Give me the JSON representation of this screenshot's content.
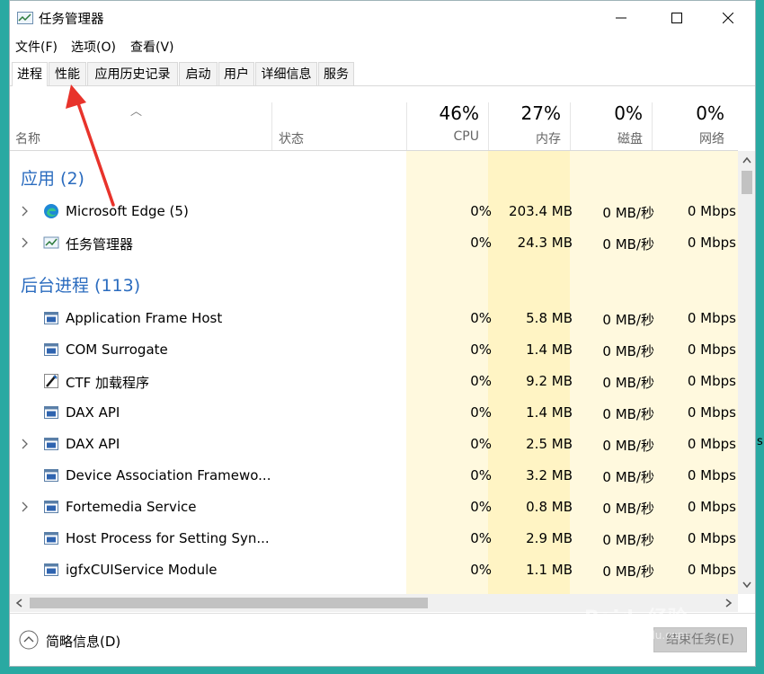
{
  "window": {
    "title": "任务管理器"
  },
  "menu": [
    "文件(F)",
    "选项(O)",
    "查看(V)"
  ],
  "tabs": [
    "进程",
    "性能",
    "应用历史记录",
    "启动",
    "用户",
    "详细信息",
    "服务"
  ],
  "headers": {
    "name": "名称",
    "status": "状态",
    "cpu": {
      "percent": "46%",
      "label": "CPU"
    },
    "memory": {
      "percent": "27%",
      "label": "内存"
    },
    "disk": {
      "percent": "0%",
      "label": "磁盘"
    },
    "network": {
      "percent": "0%",
      "label": "网络"
    }
  },
  "sections": {
    "apps": "应用 (2)",
    "background": "后台进程 (113)"
  },
  "apps": [
    {
      "name": "Microsoft Edge (5)",
      "cpu": "0%",
      "memory": "203.4 MB",
      "disk": "0 MB/秒",
      "network": "0 Mbps",
      "icon": "edge-icon",
      "expandable": true
    },
    {
      "name": "任务管理器",
      "cpu": "0%",
      "memory": "24.3 MB",
      "disk": "0 MB/秒",
      "network": "0 Mbps",
      "icon": "task-manager-icon",
      "expandable": true
    }
  ],
  "background": [
    {
      "name": "Application Frame Host",
      "cpu": "0%",
      "memory": "5.8 MB",
      "disk": "0 MB/秒",
      "network": "0 Mbps",
      "icon": "window-app-icon",
      "expandable": false
    },
    {
      "name": "COM Surrogate",
      "cpu": "0%",
      "memory": "1.4 MB",
      "disk": "0 MB/秒",
      "network": "0 Mbps",
      "icon": "window-app-icon",
      "expandable": false
    },
    {
      "name": "CTF 加载程序",
      "cpu": "0%",
      "memory": "9.2 MB",
      "disk": "0 MB/秒",
      "network": "0 Mbps",
      "icon": "ctf-pen-icon",
      "expandable": false
    },
    {
      "name": "DAX API",
      "cpu": "0%",
      "memory": "1.4 MB",
      "disk": "0 MB/秒",
      "network": "0 Mbps",
      "icon": "window-app-icon",
      "expandable": false
    },
    {
      "name": "DAX API",
      "cpu": "0%",
      "memory": "2.5 MB",
      "disk": "0 MB/秒",
      "network": "0 Mbps",
      "icon": "window-app-icon",
      "expandable": true
    },
    {
      "name": "Device Association Framewo...",
      "cpu": "0%",
      "memory": "3.2 MB",
      "disk": "0 MB/秒",
      "network": "0 Mbps",
      "icon": "window-app-icon",
      "expandable": false
    },
    {
      "name": "Fortemedia Service",
      "cpu": "0%",
      "memory": "0.8 MB",
      "disk": "0 MB/秒",
      "network": "0 Mbps",
      "icon": "window-app-icon",
      "expandable": true
    },
    {
      "name": "Host Process for Setting Syn...",
      "cpu": "0%",
      "memory": "2.9 MB",
      "disk": "0 MB/秒",
      "network": "0 Mbps",
      "icon": "window-app-icon",
      "expandable": false
    },
    {
      "name": "igfxCUIService Module",
      "cpu": "0%",
      "memory": "1.1 MB",
      "disk": "0 MB/秒",
      "network": "0 Mbps",
      "icon": "window-app-icon",
      "expandable": false
    }
  ],
  "footer": {
    "fewer_details": "简略信息(D)",
    "end_task": "结束任务(E)"
  },
  "watermark": {
    "brand": "Baidu经验",
    "url": "jingyan.baidu.com"
  },
  "colors": {
    "section": "#2b6cbf",
    "heat": "#fff4c4",
    "annotation_arrow": "#e8332b"
  }
}
